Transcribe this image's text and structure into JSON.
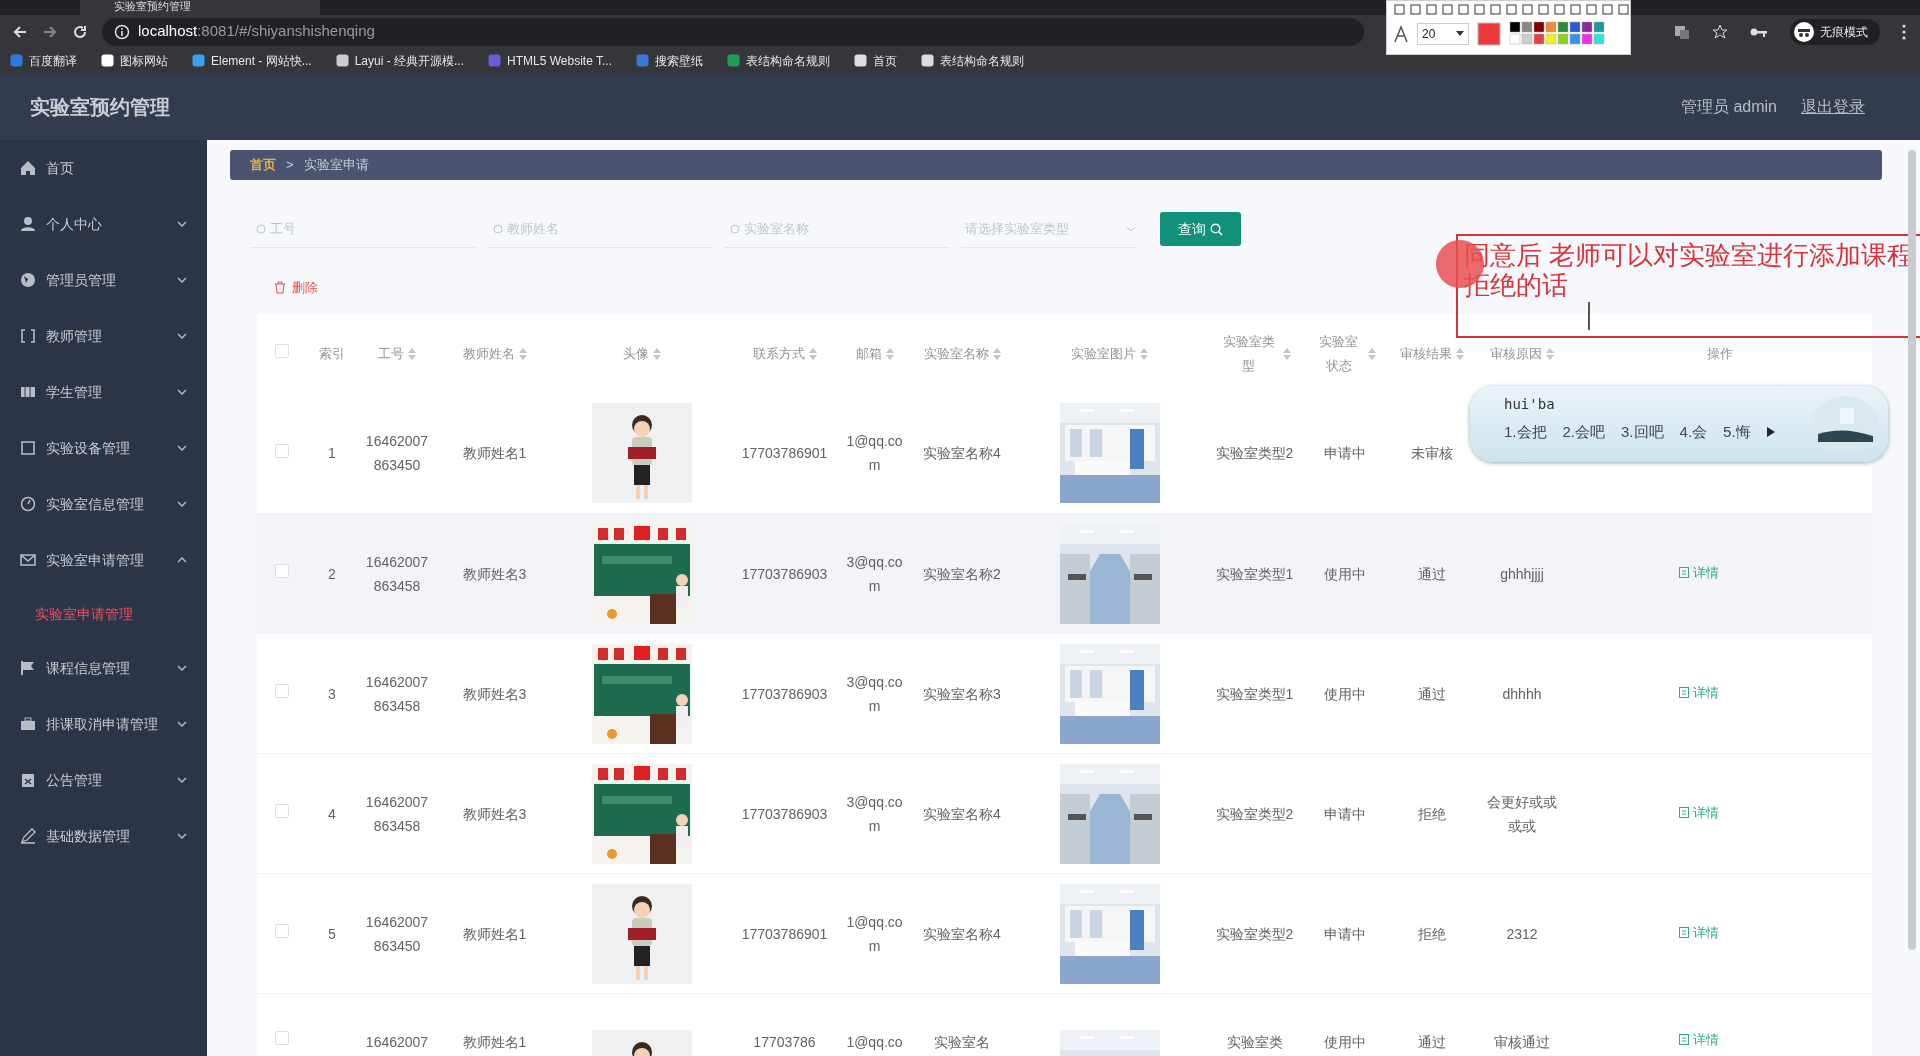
{
  "browser": {
    "tab_title": "实验室预约管理",
    "url_host": "localhost",
    "url_rest": ":8081/#/shiyanshishenqing",
    "incognito": "无痕模式",
    "bookmarks": [
      "百度翻译",
      "图标网站",
      "Element - 网站快...",
      "Layui - 经典开源模...",
      "HTML5 Website T...",
      "搜索壁纸",
      "表结构命名规则",
      "首页",
      "表结构命名规则"
    ]
  },
  "annotation_toolbar": {
    "font_size": "20"
  },
  "app": {
    "title": "实验室预约管理",
    "user": "管理员 admin",
    "logout": "退出登录"
  },
  "sidebar": {
    "items": [
      {
        "label": "首页",
        "kind": "link"
      },
      {
        "label": "个人中心",
        "kind": "submenu",
        "expanded": false
      },
      {
        "label": "管理员管理",
        "kind": "submenu",
        "expanded": false
      },
      {
        "label": "教师管理",
        "kind": "submenu",
        "expanded": false
      },
      {
        "label": "学生管理",
        "kind": "submenu",
        "expanded": false
      },
      {
        "label": "实验设备管理",
        "kind": "submenu",
        "expanded": false
      },
      {
        "label": "实验室信息管理",
        "kind": "submenu",
        "expanded": false
      },
      {
        "label": "实验室申请管理",
        "kind": "submenu",
        "expanded": true,
        "children": [
          {
            "label": "实验室申请管理",
            "selected": true
          }
        ]
      },
      {
        "label": "课程信息管理",
        "kind": "submenu",
        "expanded": false
      },
      {
        "label": "排课取消申请管理",
        "kind": "submenu",
        "expanded": false
      },
      {
        "label": "公告管理",
        "kind": "submenu",
        "expanded": false
      },
      {
        "label": "基础数据管理",
        "kind": "submenu",
        "expanded": false
      }
    ]
  },
  "breadcrumb": {
    "items": [
      "首页",
      "实验室申请"
    ],
    "separator": ">"
  },
  "search": {
    "fields": [
      {
        "placeholder": "工号"
      },
      {
        "placeholder": "教师姓名"
      },
      {
        "placeholder": "实验室名称"
      }
    ],
    "select": {
      "placeholder": "请选择实验室类型"
    },
    "button": "查询"
  },
  "delete_button": "删除",
  "table": {
    "select_all": {
      "checked": false
    },
    "columns": [
      {
        "label": "索引",
        "sortable": false
      },
      {
        "label": "工号",
        "sortable": true
      },
      {
        "label": "教师姓名",
        "sortable": true
      },
      {
        "label": "头像",
        "sortable": true
      },
      {
        "label": "联系方式",
        "sortable": true
      },
      {
        "label": "邮箱",
        "sortable": true
      },
      {
        "label": "实验室名称",
        "sortable": true
      },
      {
        "label": "实验室图片",
        "sortable": true
      },
      {
        "label": "实验室类型",
        "sortable": true
      },
      {
        "label": "实验室状态",
        "sortable": true
      },
      {
        "label": "审核结果",
        "sortable": true
      },
      {
        "label": "审核原因",
        "sortable": true
      },
      {
        "label": "操作",
        "sortable": false
      }
    ],
    "rows": [
      {
        "checked": false,
        "highlighted": false,
        "partial": false,
        "index": "1",
        "id": "16462007863450",
        "teacher": "教师姓名1",
        "phone": "17703786901",
        "email": "1@qq.com",
        "lab_name": "实验室名称4",
        "lab_type": "实验室类型2",
        "status": "申请中",
        "result": "未审核",
        "reason": "",
        "actions": []
      },
      {
        "checked": false,
        "highlighted": true,
        "partial": false,
        "index": "2",
        "id": "16462007863458",
        "teacher": "教师姓名3",
        "phone": "17703786903",
        "email": "3@qq.com",
        "lab_name": "实验室名称2",
        "lab_type": "实验室类型1",
        "status": "使用中",
        "result": "通过",
        "reason": "ghhhjjjj",
        "actions": [
          "详情"
        ]
      },
      {
        "checked": false,
        "highlighted": false,
        "partial": false,
        "index": "3",
        "id": "16462007863458",
        "teacher": "教师姓名3",
        "phone": "17703786903",
        "email": "3@qq.com",
        "lab_name": "实验室名称3",
        "lab_type": "实验室类型1",
        "status": "使用中",
        "result": "通过",
        "reason": "dhhhh",
        "actions": [
          "详情"
        ]
      },
      {
        "checked": false,
        "highlighted": false,
        "partial": false,
        "index": "4",
        "id": "16462007863458",
        "teacher": "教师姓名3",
        "phone": "17703786903",
        "email": "3@qq.com",
        "lab_name": "实验室名称4",
        "lab_type": "实验室类型2",
        "status": "申请中",
        "result": "拒绝",
        "reason": "会更好或或或或",
        "actions": [
          "详情"
        ]
      },
      {
        "checked": false,
        "highlighted": false,
        "partial": false,
        "index": "5",
        "id": "16462007863450",
        "teacher": "教师姓名1",
        "phone": "17703786901",
        "email": "1@qq.com",
        "lab_name": "实验室名称4",
        "lab_type": "实验室类型2",
        "status": "申请中",
        "result": "拒绝",
        "reason": "2312",
        "actions": [
          "详情"
        ]
      },
      {
        "checked": false,
        "highlighted": false,
        "partial": true,
        "index": "",
        "id": "16462007",
        "teacher": "教师姓名1",
        "phone": "17703786",
        "email": "1@qq.co",
        "lab_name": "实验室名",
        "lab_type": "实验室类",
        "status": "使用中",
        "result": "通过",
        "reason": "审核通过",
        "actions": [
          "详情"
        ]
      }
    ]
  },
  "annotation": {
    "lines": [
      "同意后 老师可以对实验室进行添加课程",
      "拒绝的话"
    ]
  },
  "ime": {
    "input": "hui'ba",
    "candidates": [
      "1.会把",
      "2.会吧",
      "3.回吧",
      "4.会",
      "5.悔"
    ]
  }
}
